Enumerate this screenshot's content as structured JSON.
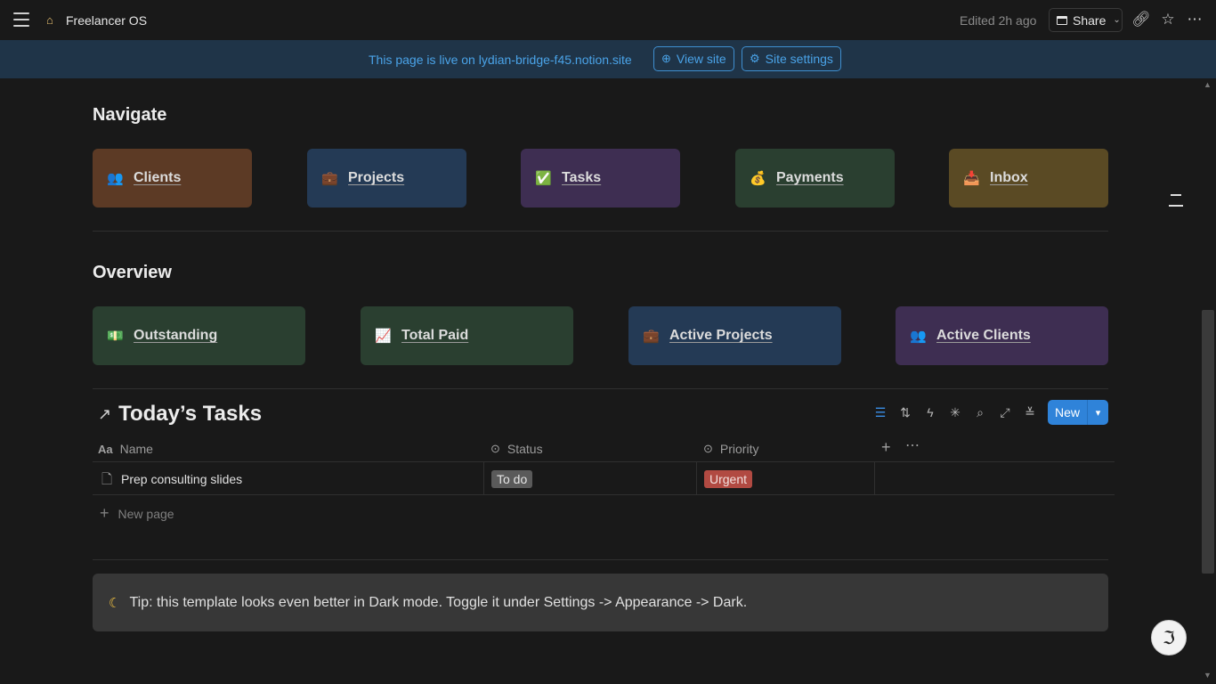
{
  "topbar": {
    "page_title": "Freelancer OS",
    "page_icon": "house-icon",
    "edited": "Edited 2h ago",
    "share_label": "Share"
  },
  "banner": {
    "text": "This page is live on lydian-bridge-f45.notion.site",
    "view_site_label": "View site",
    "site_settings_label": "Site settings",
    "color": "#4aa3e8"
  },
  "navigate": {
    "heading": "Navigate",
    "cards": [
      {
        "label": "Clients",
        "icon": "people-icon",
        "emoji": "👥",
        "bg": "#5c3a25"
      },
      {
        "label": "Projects",
        "icon": "briefcase-icon",
        "emoji": "💼",
        "bg": "#243a55"
      },
      {
        "label": "Tasks",
        "icon": "checkbox-icon",
        "emoji": "✅",
        "bg": "#3e2e52"
      },
      {
        "label": "Payments",
        "icon": "money-bag-icon",
        "emoji": "💰",
        "bg": "#2a3f30"
      },
      {
        "label": "Inbox",
        "icon": "inbox-tray-icon",
        "emoji": "📥",
        "bg": "#5a4a24"
      }
    ]
  },
  "overview": {
    "heading": "Overview",
    "cards": [
      {
        "label": "Outstanding",
        "icon": "dollar-banknote-icon",
        "emoji": "💵",
        "bg": "#2a3f30"
      },
      {
        "label": "Total Paid",
        "icon": "chart-increasing-icon",
        "emoji": "📈",
        "bg": "#2a3f30"
      },
      {
        "label": "Active Projects",
        "icon": "briefcase-icon",
        "emoji": "💼",
        "bg": "#243a55"
      },
      {
        "label": "Active Clients",
        "icon": "people-icon",
        "emoji": "👥",
        "bg": "#3e2e52"
      }
    ]
  },
  "tasks_db": {
    "title": "Today’s Tasks",
    "new_label": "New",
    "columns": [
      {
        "label": "Name",
        "icon": "text-property-icon"
      },
      {
        "label": "Status",
        "icon": "status-property-icon"
      },
      {
        "label": "Priority",
        "icon": "status-property-icon"
      }
    ],
    "rows": [
      {
        "name": "Prep consulting slides",
        "status": "To do",
        "priority": "Urgent"
      }
    ],
    "status_color": "#5a5a5a",
    "priority_color": "#b14a42",
    "new_page_label": "New page"
  },
  "callout": {
    "icon": "crescent-moon-icon",
    "text": "Tip: this template looks even better in Dark mode. Toggle it under Settings -> Appearance -> Dark."
  }
}
